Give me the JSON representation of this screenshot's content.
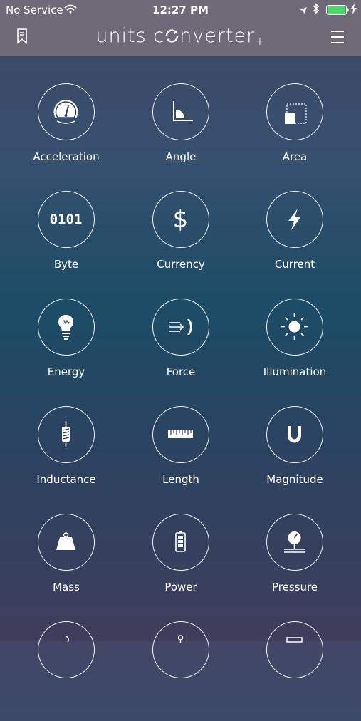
{
  "status_bar": {
    "carrier": "No Service",
    "time": "12:27 PM"
  },
  "nav": {
    "title_prefix": "units c",
    "title_suffix": "nverter",
    "title_plus": "+"
  },
  "units": [
    {
      "label": "Acceleration",
      "icon": "speedometer-icon"
    },
    {
      "label": "Angle",
      "icon": "angle-icon"
    },
    {
      "label": "Area",
      "icon": "area-icon"
    },
    {
      "label": "Byte",
      "icon": "binary-icon"
    },
    {
      "label": "Currency",
      "icon": "dollar-icon"
    },
    {
      "label": "Current",
      "icon": "lightning-icon"
    },
    {
      "label": "Energy",
      "icon": "lightbulb-icon"
    },
    {
      "label": "Force",
      "icon": "force-icon"
    },
    {
      "label": "Illumination",
      "icon": "sun-icon"
    },
    {
      "label": "Inductance",
      "icon": "inductor-icon"
    },
    {
      "label": "Length",
      "icon": "ruler-icon"
    },
    {
      "label": "Magnitude",
      "icon": "magnet-icon"
    },
    {
      "label": "Mass",
      "icon": "weight-icon"
    },
    {
      "label": "Power",
      "icon": "battery-icon"
    },
    {
      "label": "Pressure",
      "icon": "gauge-icon"
    },
    {
      "label": "",
      "icon": "partial-icon"
    },
    {
      "label": "",
      "icon": "partial-icon"
    },
    {
      "label": "",
      "icon": "partial-icon"
    }
  ],
  "colors": {
    "bar_background": "#6e6a78",
    "battery_fill": "#4cd964"
  }
}
